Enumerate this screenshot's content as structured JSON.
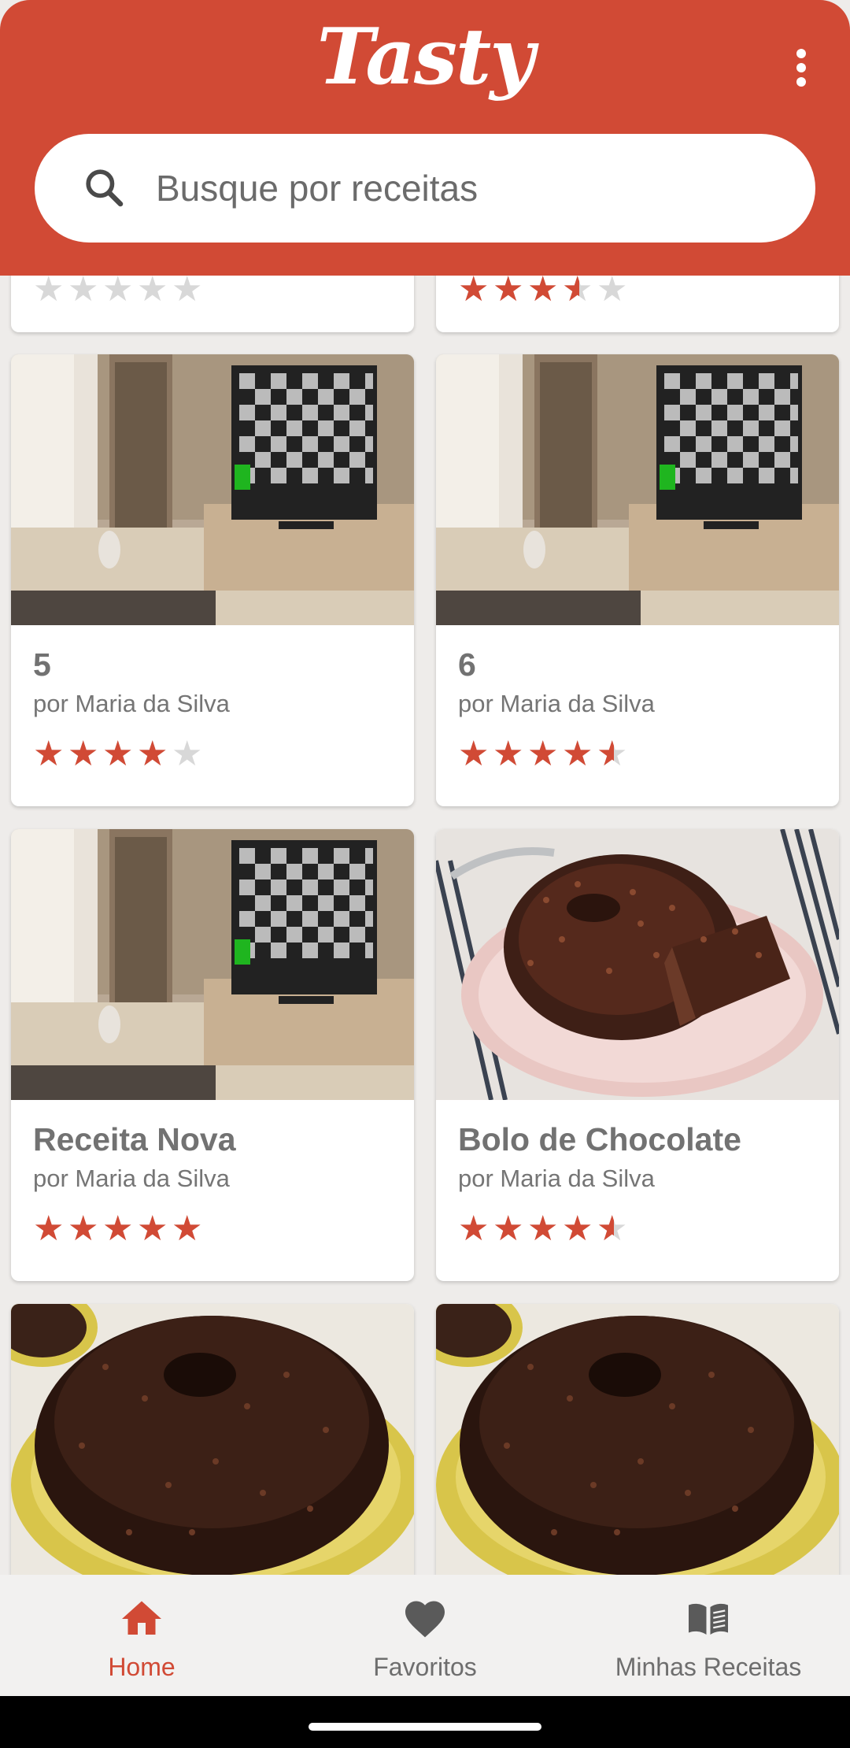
{
  "app": {
    "logo_text": "Tasty",
    "brand_color": "#d14a35"
  },
  "header": {
    "menu_icon": "more-vert-icon"
  },
  "search": {
    "placeholder": "Busque por receitas",
    "icon": "search-icon"
  },
  "cards": [
    {
      "title": "",
      "author": "",
      "rating": 0,
      "image": "partial"
    },
    {
      "title": "",
      "author": "",
      "rating": 3.5,
      "image": "partial"
    },
    {
      "title": "5",
      "author": "por Maria da Silva",
      "rating": 4,
      "image": "tv-room"
    },
    {
      "title": "6",
      "author": "por Maria da Silva",
      "rating": 4.5,
      "image": "tv-room"
    },
    {
      "title": "Receita Nova",
      "author": "por Maria da Silva",
      "rating": 5,
      "image": "tv-room"
    },
    {
      "title": "Bolo de Chocolate",
      "author": "por Maria da Silva",
      "rating": 4.5,
      "image": "chocolate-cake-sliced"
    },
    {
      "title": "",
      "author": "",
      "rating": null,
      "image": "chocolate-cake-sprinkles"
    },
    {
      "title": "",
      "author": "",
      "rating": null,
      "image": "chocolate-cake-sprinkles"
    }
  ],
  "nav": {
    "items": [
      {
        "label": "Home",
        "icon": "home-icon",
        "active": true
      },
      {
        "label": "Favoritos",
        "icon": "heart-icon",
        "active": false
      },
      {
        "label": "Minhas Receitas",
        "icon": "book-icon",
        "active": false
      }
    ]
  }
}
